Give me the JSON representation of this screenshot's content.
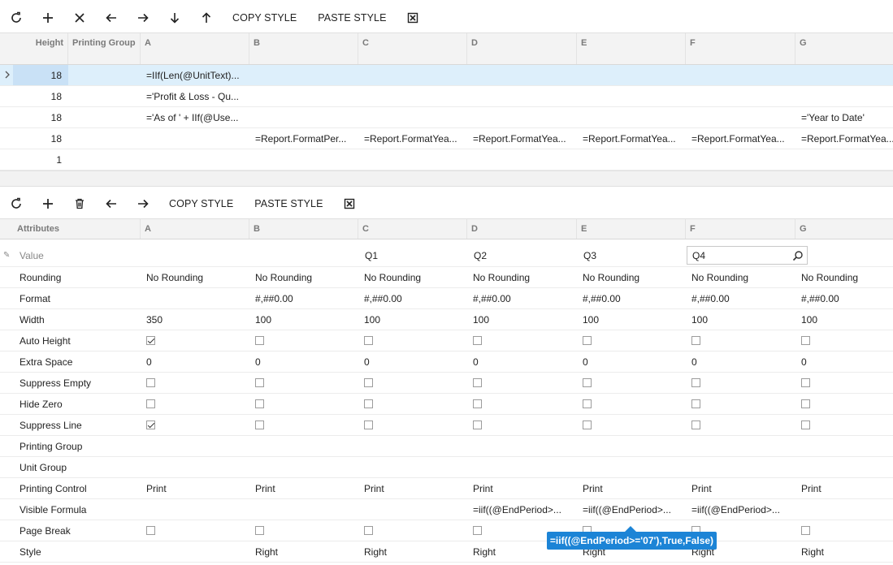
{
  "top_toolbar": {
    "copy_style": "COPY STYLE",
    "paste_style": "PASTE STYLE"
  },
  "top_grid": {
    "headers": [
      "Height",
      "Printing Group",
      "A",
      "B",
      "C",
      "D",
      "E",
      "F",
      "G"
    ],
    "rows": [
      {
        "height": "18",
        "printing_group": "",
        "A": "=IIf(Len(@UnitText)...",
        "B": "",
        "C": "",
        "D": "",
        "E": "",
        "F": "",
        "G": ""
      },
      {
        "height": "18",
        "printing_group": "",
        "A": "='Profit & Loss - Qu...",
        "B": "",
        "C": "",
        "D": "",
        "E": "",
        "F": "",
        "G": ""
      },
      {
        "height": "18",
        "printing_group": "",
        "A": "='As of ' + IIf(@Use...",
        "B": "",
        "C": "",
        "D": "",
        "E": "",
        "F": "",
        "G": "='Year to Date'"
      },
      {
        "height": "18",
        "printing_group": "",
        "A": "",
        "B": "=Report.FormatPer...",
        "C": "=Report.FormatYea...",
        "D": "=Report.FormatYea...",
        "E": "=Report.FormatYea...",
        "F": "=Report.FormatYea...",
        "G": "=Report.FormatYea..."
      },
      {
        "height": "1",
        "printing_group": "",
        "A": "",
        "B": "",
        "C": "",
        "D": "",
        "E": "",
        "F": "",
        "G": ""
      }
    ]
  },
  "bottom_toolbar": {
    "copy_style": "COPY STYLE",
    "paste_style": "PASTE STYLE"
  },
  "bottom_grid": {
    "headers": [
      "Attributes",
      "A",
      "B",
      "C",
      "D",
      "E",
      "F",
      "G"
    ],
    "value_row": {
      "label": "Value",
      "A": "",
      "B": "",
      "C": "Q1",
      "D": "Q2",
      "E": "Q3",
      "F": "Q4",
      "G": ""
    },
    "rows": [
      {
        "label": "Rounding",
        "type": "text",
        "values": [
          "No Rounding",
          "No Rounding",
          "No Rounding",
          "No Rounding",
          "No Rounding",
          "No Rounding",
          "No Rounding"
        ]
      },
      {
        "label": "Format",
        "type": "text",
        "values": [
          "",
          "#,##0.00",
          "#,##0.00",
          "#,##0.00",
          "#,##0.00",
          "#,##0.00",
          "#,##0.00"
        ]
      },
      {
        "label": "Width",
        "type": "text",
        "values": [
          "350",
          "100",
          "100",
          "100",
          "100",
          "100",
          "100"
        ]
      },
      {
        "label": "Auto Height",
        "type": "check",
        "values": [
          true,
          false,
          false,
          false,
          false,
          false,
          false
        ]
      },
      {
        "label": "Extra Space",
        "type": "text",
        "values": [
          "0",
          "0",
          "0",
          "0",
          "0",
          "0",
          "0"
        ]
      },
      {
        "label": "Suppress Empty",
        "type": "check",
        "values": [
          false,
          false,
          false,
          false,
          false,
          false,
          false
        ]
      },
      {
        "label": "Hide Zero",
        "type": "check",
        "values": [
          false,
          false,
          false,
          false,
          false,
          false,
          false
        ]
      },
      {
        "label": "Suppress Line",
        "type": "check",
        "values": [
          true,
          false,
          false,
          false,
          false,
          false,
          false
        ]
      },
      {
        "label": "Printing Group",
        "type": "text",
        "values": [
          "",
          "",
          "",
          "",
          "",
          "",
          ""
        ]
      },
      {
        "label": "Unit Group",
        "type": "text",
        "values": [
          "",
          "",
          "",
          "",
          "",
          "",
          ""
        ]
      },
      {
        "label": "Printing Control",
        "type": "text",
        "values": [
          "Print",
          "Print",
          "Print",
          "Print",
          "Print",
          "Print",
          "Print"
        ]
      },
      {
        "label": "Visible Formula",
        "type": "text",
        "values": [
          "",
          "",
          "",
          "=iif((@EndPeriod>...",
          "=iif((@EndPeriod>...",
          "=iif((@EndPeriod>...",
          ""
        ]
      },
      {
        "label": "Page Break",
        "type": "check",
        "values": [
          false,
          false,
          false,
          false,
          false,
          false,
          false
        ]
      },
      {
        "label": "Style",
        "type": "text",
        "values": [
          "",
          "Right",
          "Right",
          "Right",
          "Right",
          "Right",
          "Right"
        ]
      }
    ]
  },
  "tooltip": {
    "text": "=iif((@EndPeriod>='07'),True,False)"
  }
}
